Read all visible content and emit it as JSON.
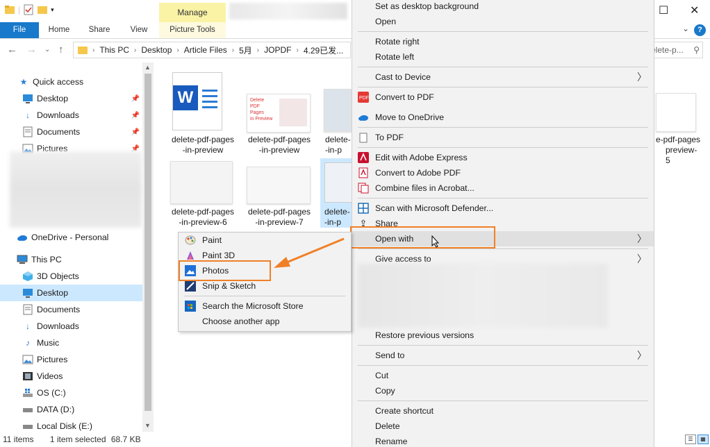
{
  "titlebar": {
    "manage_label": "Manage",
    "minimize": "—",
    "maximize": "☐",
    "close": "✕"
  },
  "ribbon": {
    "tabs": [
      "File",
      "Home",
      "Share",
      "View",
      "Picture Tools"
    ]
  },
  "address": {
    "path": [
      "This PC",
      "Desktop",
      "Article Files",
      "5月",
      "JOPDF",
      "4.29已发..."
    ],
    "search_placeholder": "elete-p..."
  },
  "nav_pane": {
    "items": [
      {
        "label": "Quick access",
        "icon": "star-icon"
      },
      {
        "label": "Desktop",
        "icon": "desktop-icon",
        "pinned": true
      },
      {
        "label": "Downloads",
        "icon": "download-icon",
        "pinned": true
      },
      {
        "label": "Documents",
        "icon": "documents-icon",
        "pinned": true
      },
      {
        "label": "Pictures",
        "icon": "pictures-icon",
        "pinned": true
      },
      {
        "label": "OneDrive - Personal",
        "icon": "cloud-icon"
      },
      {
        "label": "This PC",
        "icon": "pc-icon"
      },
      {
        "label": "3D Objects",
        "icon": "cube-icon"
      },
      {
        "label": "Desktop",
        "icon": "desktop-icon",
        "selected": true
      },
      {
        "label": "Documents",
        "icon": "documents-icon"
      },
      {
        "label": "Downloads",
        "icon": "download-icon"
      },
      {
        "label": "Music",
        "icon": "music-icon"
      },
      {
        "label": "Pictures",
        "icon": "pictures-icon"
      },
      {
        "label": "Videos",
        "icon": "video-icon"
      },
      {
        "label": "OS (C:)",
        "icon": "drive-icon"
      },
      {
        "label": "DATA (D:)",
        "icon": "drive-icon"
      },
      {
        "label": "Local Disk (E:)",
        "icon": "drive-icon"
      }
    ]
  },
  "files": [
    {
      "line1": "delete-pdf-pages",
      "line2": "-in-preview"
    },
    {
      "line1": "delete-pdf-pages",
      "line2": "-in-preview"
    },
    {
      "line1": "delete-",
      "line2": "-in-p"
    },
    {
      "line1": "delete-pdf-pages",
      "line2": "-in-preview-6"
    },
    {
      "line1": "delete-pdf-pages",
      "line2": "-in-preview-7"
    },
    {
      "line1": "delete-",
      "line2": "-in-p"
    },
    {
      "line1": "e-pdf-pages",
      "line2": "preview-5"
    }
  ],
  "thumb_text": {
    "line1": "Delete PDF",
    "line2": "Pages",
    "line3": "in Preview"
  },
  "context_menu": {
    "items": [
      {
        "label": "Set as desktop background"
      },
      {
        "label": "Open"
      },
      {
        "label": "Rotate right"
      },
      {
        "label": "Rotate left"
      },
      {
        "label": "Cast to Device",
        "submenu": true
      },
      {
        "label": "Convert to PDF"
      },
      {
        "label": "Move to OneDrive"
      },
      {
        "label": "To PDF"
      },
      {
        "label": "Edit with Adobe Express"
      },
      {
        "label": "Convert to Adobe PDF"
      },
      {
        "label": "Combine files in Acrobat..."
      },
      {
        "label": "Scan with Microsoft Defender..."
      },
      {
        "label": "Share"
      },
      {
        "label": "Open with",
        "submenu": true,
        "highlighted": true
      },
      {
        "label": "Give access to",
        "submenu": true
      },
      {
        "label": "Restore previous versions"
      },
      {
        "label": "Send to",
        "submenu": true
      },
      {
        "label": "Cut"
      },
      {
        "label": "Copy"
      },
      {
        "label": "Create shortcut"
      },
      {
        "label": "Delete"
      },
      {
        "label": "Rename"
      }
    ]
  },
  "open_with": {
    "items": [
      {
        "label": "Paint"
      },
      {
        "label": "Paint 3D"
      },
      {
        "label": "Photos"
      },
      {
        "label": "Snip & Sketch"
      },
      {
        "label": "Search the Microsoft Store"
      },
      {
        "label": "Choose another app"
      }
    ]
  },
  "status": {
    "count": "11 items",
    "selection": "1 item selected",
    "size": "68.7 KB"
  },
  "colors": {
    "accent": "#1979ca",
    "highlight_box": "#f08026",
    "selection": "#cce8ff"
  }
}
